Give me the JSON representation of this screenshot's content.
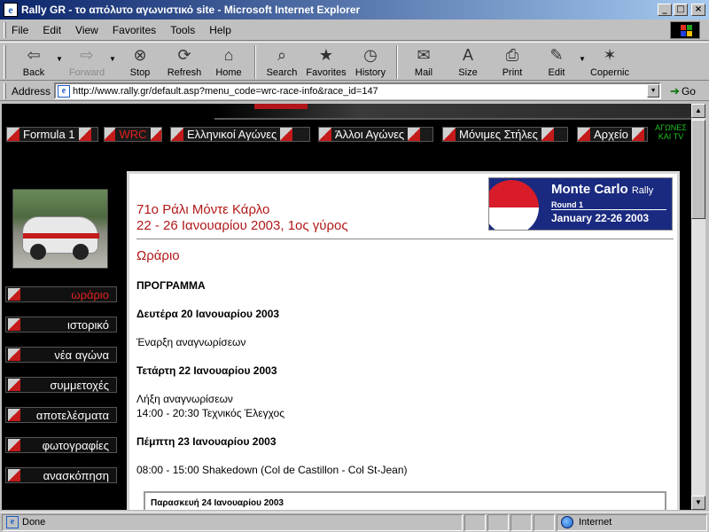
{
  "window": {
    "title": "Rally GR - το απόλυτο αγωνιστικό site - Microsoft Internet Explorer"
  },
  "menu": [
    "File",
    "Edit",
    "View",
    "Favorites",
    "Tools",
    "Help"
  ],
  "toolbar": {
    "back": "Back",
    "forward": "Forward",
    "stop": "Stop",
    "refresh": "Refresh",
    "home": "Home",
    "search": "Search",
    "favorites": "Favorites",
    "history": "History",
    "mail": "Mail",
    "size": "Size",
    "print": "Print",
    "edit": "Edit",
    "copernic": "Copernic"
  },
  "address": {
    "label": "Address",
    "url": "http://www.rally.gr/default.asp?menu_code=wrc-race-info&race_id=147",
    "go": "Go"
  },
  "topnav": [
    {
      "label": "Formula 1",
      "active": false
    },
    {
      "label": "WRC",
      "active": true
    },
    {
      "label": "Ελληνικοί Αγώνες",
      "active": false
    },
    {
      "label": "Άλλοι Αγώνες",
      "active": false
    },
    {
      "label": "Μόνιμες Στήλες",
      "active": false
    },
    {
      "label": "Αρχείο",
      "active": false
    }
  ],
  "toplink": {
    "line1": "ΑΓΩΝΕΣ",
    "line2": "ΚΑΙ TV"
  },
  "sidenav": [
    {
      "label": "ωράριο",
      "active": true
    },
    {
      "label": "ιστορικό",
      "active": false
    },
    {
      "label": "νέα αγώνα",
      "active": false
    },
    {
      "label": "συμμετοχές",
      "active": false
    },
    {
      "label": "αποτελέσματα",
      "active": false
    },
    {
      "label": "φωτογραφίες",
      "active": false
    },
    {
      "label": "ανασκόπηση",
      "active": false
    }
  ],
  "logo": {
    "name": "Monte Carlo",
    "suffix": "Rally",
    "round": "Round 1",
    "dates": "January 22-26 2003"
  },
  "event": {
    "title_line1": "71ο Ράλι Μόντε Κάρλο",
    "title_line2": "22 - 26 Ιανουαρίου 2003, 1ος γύρος",
    "section": "Ωράριο",
    "program": "ΠΡΟΓΡΑΜΜΑ",
    "day1": "Δευτέρα 20 Ιανουαρίου 2003",
    "day1_item1": "Έναρξη αναγνωρίσεων",
    "day2": "Τετάρτη 22 Ιανουαρίου 2003",
    "day2_item1": "Λήξη αναγνωρίσεων",
    "day2_item2": "14:00 - 20:30 Τεχνικός Έλεγχος",
    "day3": "Πέμπτη 23 Ιανουαρίου 2003",
    "day3_item1": "08:00 - 15:00 Shakedown (Col de Castillon - Col St-Jean)",
    "day4": "Παρασκευή 24 Ιανουαρίου 2003"
  },
  "status": {
    "left": "Done",
    "zone": "Internet"
  }
}
